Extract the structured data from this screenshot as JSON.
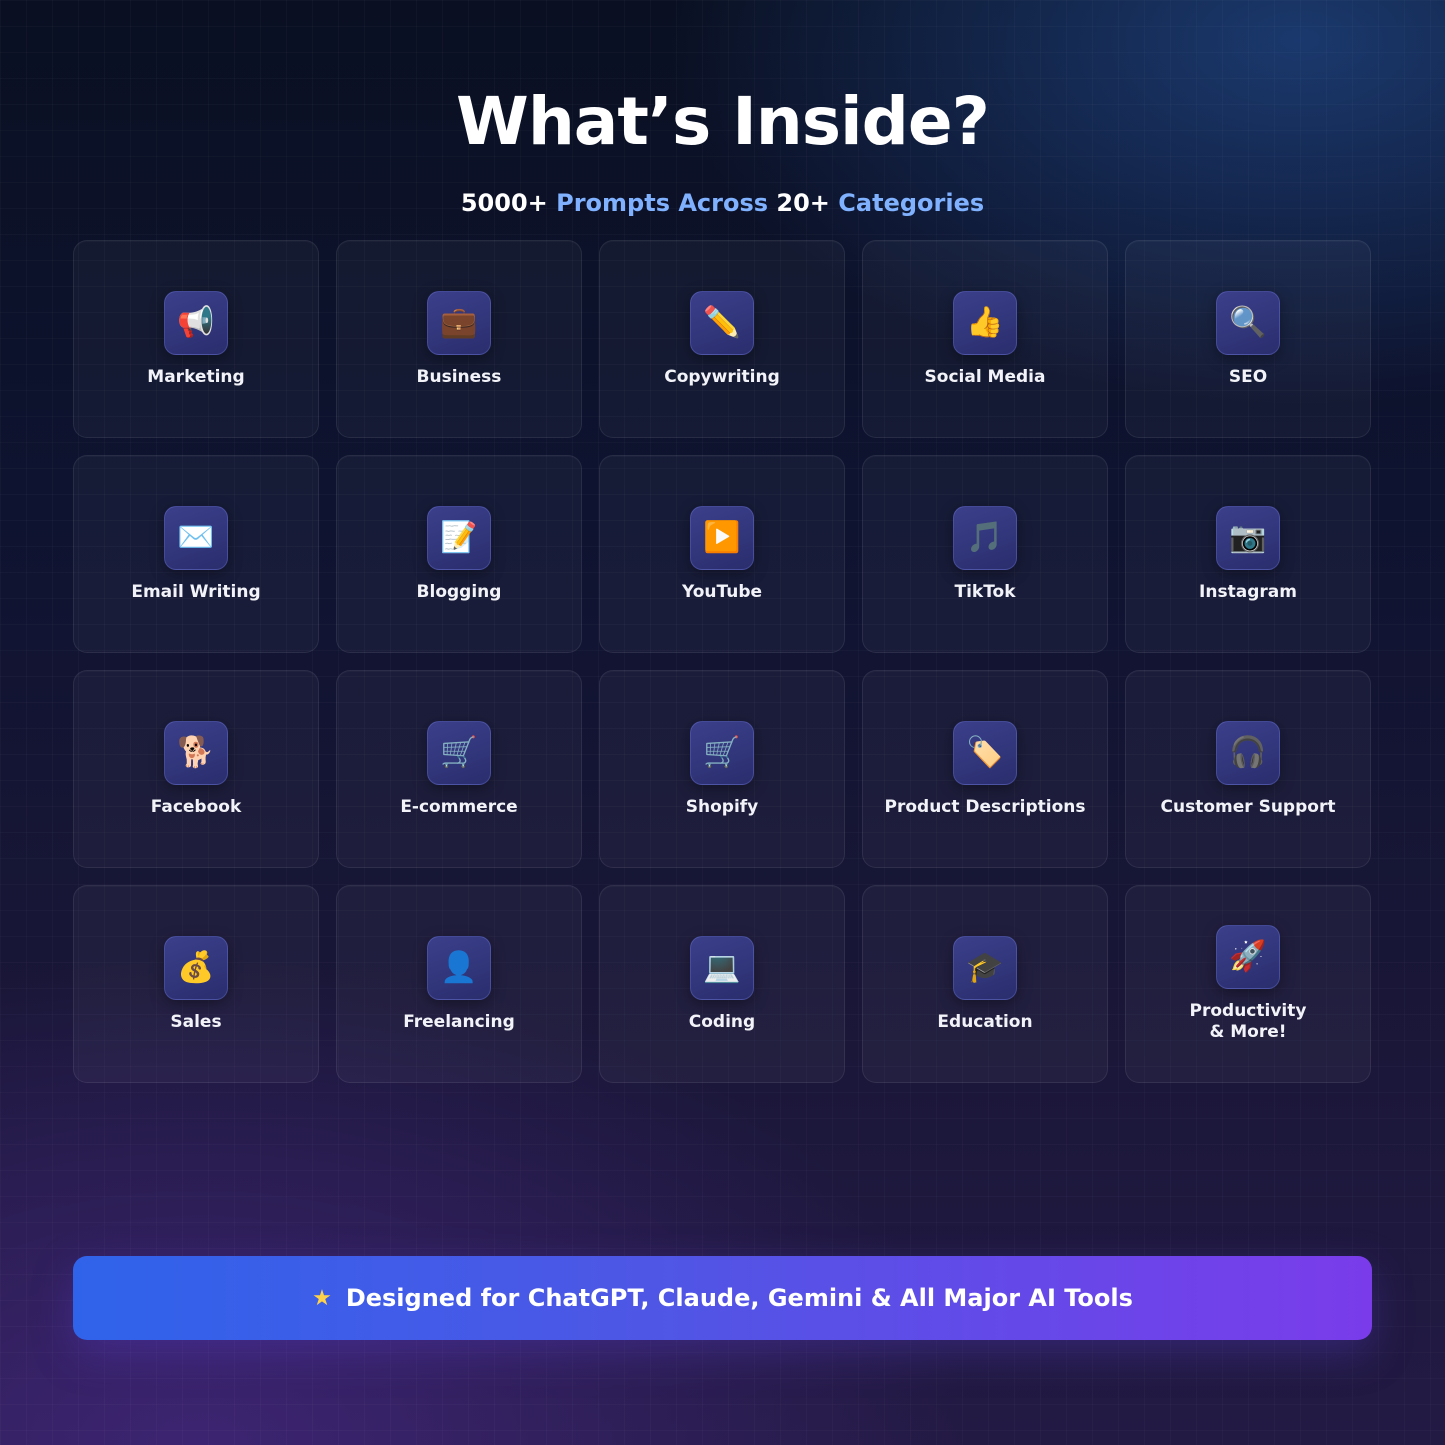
{
  "header": {
    "title": "What’s Inside?",
    "subtitle": {
      "part1": "5000+",
      "part2": "Prompts Across",
      "part3": "20+",
      "part4": "Categories"
    }
  },
  "colors": {
    "highlight": "#7fb1ff",
    "banner_start": "#2f63ea",
    "banner_end": "#7a3cea",
    "star": "#ffd24a"
  },
  "categories": [
    {
      "label": "Marketing",
      "icon": "megaphone-icon",
      "glyph": "📢"
    },
    {
      "label": "Business",
      "icon": "briefcase-icon",
      "glyph": "💼"
    },
    {
      "label": "Copywriting",
      "icon": "pencil-icon",
      "glyph": "✏️"
    },
    {
      "label": "Social Media",
      "icon": "thumbs-up-icon",
      "glyph": "👍"
    },
    {
      "label": "SEO",
      "icon": "magnifier-icon",
      "glyph": "🔍"
    },
    {
      "label": "Email Writing",
      "icon": "envelope-icon",
      "glyph": "✉️"
    },
    {
      "label": "Blogging",
      "icon": "memo-icon",
      "glyph": "📝"
    },
    {
      "label": "YouTube",
      "icon": "play-button-icon",
      "glyph": "▶️"
    },
    {
      "label": "TikTok",
      "icon": "music-note-icon",
      "glyph": "🎵"
    },
    {
      "label": "Instagram",
      "icon": "camera-icon",
      "glyph": "📷"
    },
    {
      "label": "Facebook",
      "icon": "dog-icon",
      "glyph": "🐕"
    },
    {
      "label": "E-commerce",
      "icon": "shopping-cart-icon",
      "glyph": "🛒"
    },
    {
      "label": "Shopify",
      "icon": "shopping-cart-icon",
      "glyph": "🛒"
    },
    {
      "label": "Product Descriptions",
      "icon": "price-tag-icon",
      "glyph": "🏷️"
    },
    {
      "label": "Customer Support",
      "icon": "headphones-icon",
      "glyph": "🎧"
    },
    {
      "label": "Sales",
      "icon": "money-bag-icon",
      "glyph": "💰"
    },
    {
      "label": "Freelancing",
      "icon": "person-icon",
      "glyph": "👤"
    },
    {
      "label": "Coding",
      "icon": "laptop-icon",
      "glyph": "💻"
    },
    {
      "label": "Education",
      "icon": "graduation-cap-icon",
      "glyph": "🎓"
    },
    {
      "label": "Productivity\n& More!",
      "icon": "rocket-icon",
      "glyph": "🚀"
    }
  ],
  "banner": {
    "star": "★",
    "text": "Designed for ChatGPT, Claude, Gemini & All Major AI Tools"
  }
}
